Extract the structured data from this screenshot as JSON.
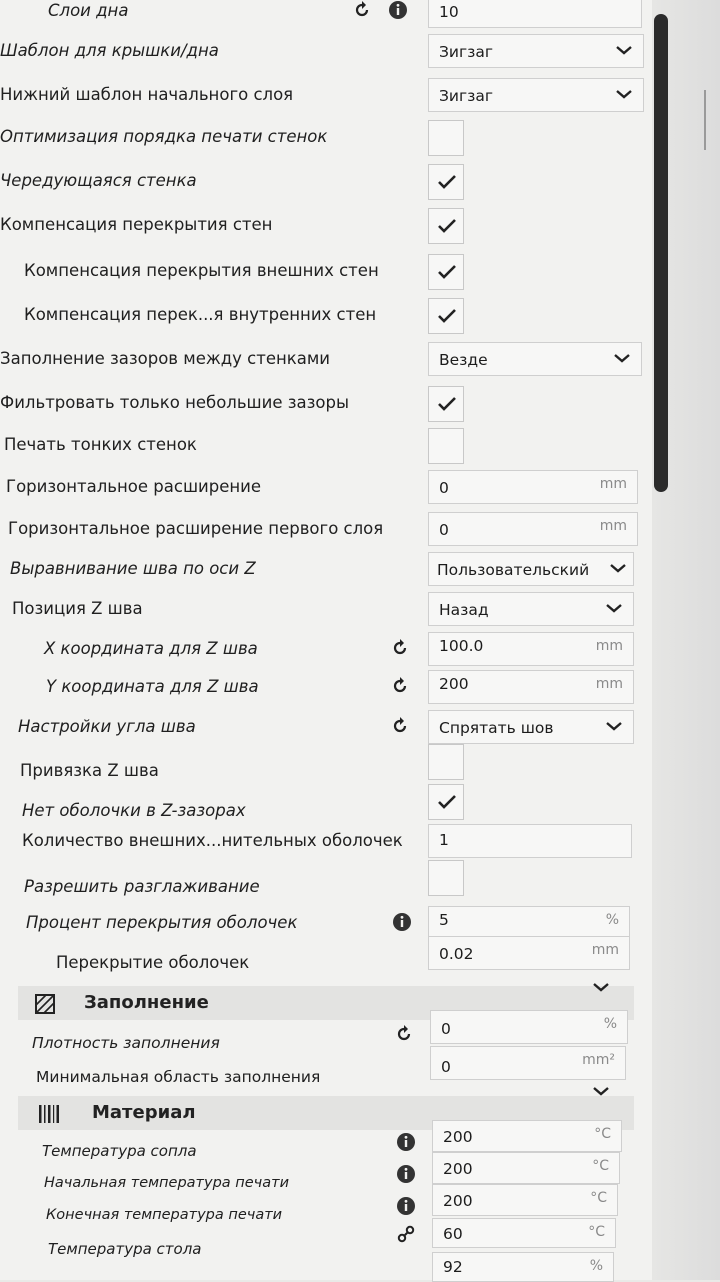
{
  "settings": {
    "top_bottom_layers": {
      "label": "Слои дна",
      "value": "10"
    },
    "top_bottom_pattern": {
      "label": "Шаблон для крышки/дна",
      "value": "Зигзаг"
    },
    "initial_layer_pattern": {
      "label": "Нижний шаблон начального слоя",
      "value": "Зигзаг"
    },
    "wall_order": {
      "label": "Оптимизация порядка печати стенок"
    },
    "alternate_wall": {
      "label": "Чередующаяся стенка"
    },
    "overlap_comp": {
      "label": "Компенсация перекрытия стен"
    },
    "outer_overlap": {
      "label": "Компенсация перекрытия внешних стен"
    },
    "inner_overlap": {
      "label": "Компенсация перек...я внутренних стен"
    },
    "fill_gaps": {
      "label": "Заполнение зазоров между стенками",
      "value": "Везде"
    },
    "filter_gaps": {
      "label": "Фильтровать только небольшие зазоры"
    },
    "thin_walls": {
      "label": "Печать тонких стенок"
    },
    "horiz_expansion": {
      "label": "Горизонтальное расширение",
      "value": "0",
      "unit": "mm"
    },
    "horiz_expansion_first": {
      "label": "Горизонтальное расширение первого слоя",
      "value": "0",
      "unit": "mm"
    },
    "z_seam_align": {
      "label": "Выравнивание шва по оси Z",
      "value": "Пользовательский"
    },
    "z_seam_pos": {
      "label": "Позиция Z шва",
      "value": "Назад"
    },
    "z_seam_x": {
      "label": "X координата для Z шва",
      "value": "100.0",
      "unit": "mm"
    },
    "z_seam_y": {
      "label": "Y координата для Z шва",
      "value": "200",
      "unit": "mm"
    },
    "seam_corner": {
      "label": "Настройки угла шва",
      "value": "Спрятать шов"
    },
    "z_seam_snap": {
      "label": "Привязка Z шва"
    },
    "no_skin_z_gaps": {
      "label": "Нет оболочки в Z-зазорах"
    },
    "extra_skin_walls": {
      "label": "Количество внешних...нительных оболочек",
      "value": "1"
    },
    "ironing": {
      "label": "Разрешить разглаживание"
    },
    "skin_overlap_pct": {
      "label": "Процент перекрытия оболочек",
      "value": "5",
      "unit": "%"
    },
    "skin_overlap": {
      "label": "Перекрытие оболочек",
      "value": "0.02",
      "unit": "mm"
    }
  },
  "infill": {
    "title": "Заполнение",
    "density": {
      "label": "Плотность заполнения",
      "value": "0",
      "unit": "%"
    },
    "min_area": {
      "label": "Минимальная область заполнения",
      "value": "0",
      "unit": "mm²"
    }
  },
  "material": {
    "title": "Материал",
    "nozzle_temp": {
      "label": "Температура сопла",
      "value": "200",
      "unit": "°C"
    },
    "initial_temp": {
      "label": "Начальная температура печати",
      "value": "200",
      "unit": "°C"
    },
    "final_temp": {
      "label": "Конечная температура печати",
      "value": "200",
      "unit": "°C"
    },
    "bed_temp": {
      "label": "Температура стола",
      "value": "60",
      "unit": "°C"
    },
    "next_value": {
      "value": "92",
      "unit": "%"
    }
  },
  "colors": {
    "panel": "#f2f2f0",
    "section": "#e3e3e1",
    "scrollbar": "#2b2b2b"
  }
}
